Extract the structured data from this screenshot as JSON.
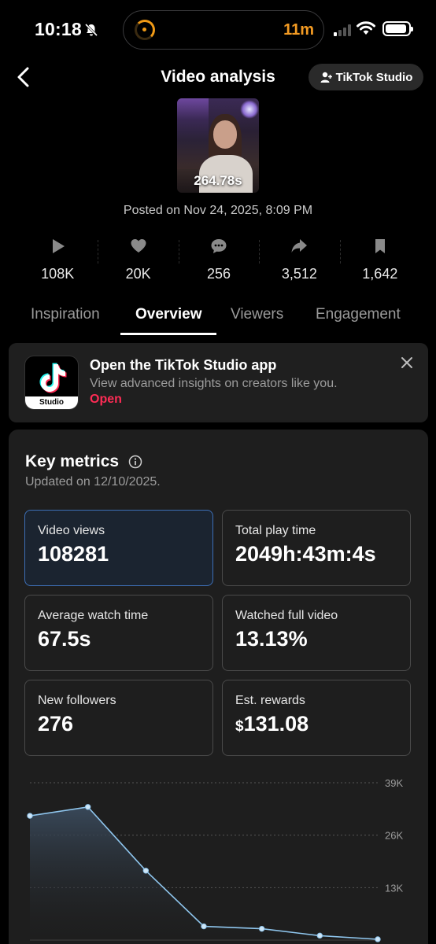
{
  "status_bar": {
    "time": "10:18",
    "activity_timer": "11m"
  },
  "header": {
    "title": "Video analysis",
    "studio_button": "TikTok Studio"
  },
  "video": {
    "duration": "264.78s",
    "posted": "Posted on Nov 24, 2025, 8:09 PM"
  },
  "stats": {
    "views": "108K",
    "likes": "20K",
    "comments": "256",
    "shares": "3,512",
    "saves": "1,642"
  },
  "tabs": [
    {
      "label": "Inspiration"
    },
    {
      "label": "Overview"
    },
    {
      "label": "Viewers"
    },
    {
      "label": "Engagement"
    }
  ],
  "promo": {
    "app_icon_label": "Studio",
    "title": "Open the TikTok Studio app",
    "subtitle": "View advanced insights on creators like you.",
    "link": "Open"
  },
  "key_metrics": {
    "title": "Key metrics",
    "updated": "Updated on 12/10/2025.",
    "video_views": {
      "label": "Video views",
      "value": "108281"
    },
    "total_play_time": {
      "label": "Total play time",
      "value": "2049h:43m:4s"
    },
    "avg_watch_time": {
      "label": "Average watch time",
      "value": "67.5s"
    },
    "watched_full": {
      "label": "Watched full video",
      "value": "13.13%"
    },
    "new_followers": {
      "label": "New followers",
      "value": "276"
    },
    "est_rewards": {
      "label": "Est. rewards",
      "currency": "$",
      "value": "131.08"
    }
  },
  "chart_data": {
    "type": "area",
    "y_ticks": [
      "39K",
      "26K",
      "13K"
    ],
    "ylim": [
      0,
      39000
    ],
    "values": [
      30800,
      33000,
      17200,
      3400,
      2800,
      1100,
      200
    ],
    "colors": {
      "line": "#8fc6ee",
      "fill": "#3a4a5c"
    }
  }
}
